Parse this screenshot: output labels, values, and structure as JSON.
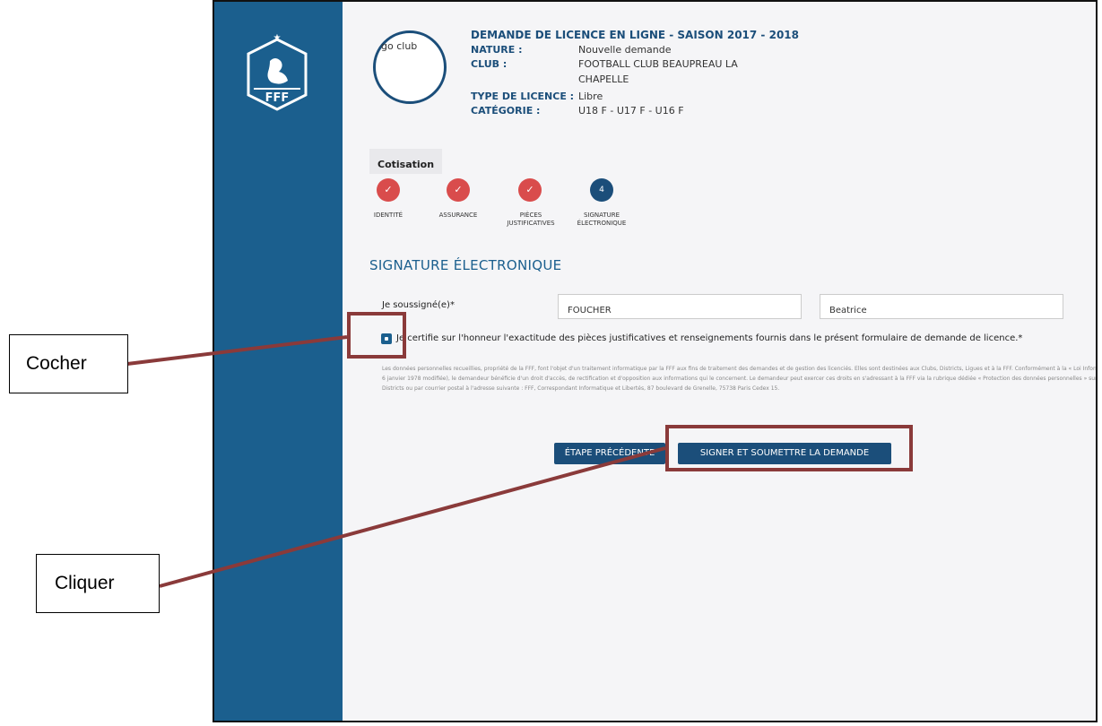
{
  "header": {
    "title": "DEMANDE DE LICENCE EN LIGNE - SAISON 2017 - 2018",
    "club_logo_text": "go club",
    "rows": [
      {
        "label": "NATURE :",
        "value": "Nouvelle demande"
      },
      {
        "label": "CLUB :",
        "value": "FOOTBALL CLUB BEAUPREAU LA",
        "value2": "CHAPELLE"
      },
      {
        "label": "TYPE DE LICENCE :",
        "value": "Libre"
      },
      {
        "label": "CATÉGORIE :",
        "value": "U18 F - U17 F - U16 F"
      }
    ]
  },
  "tab": "Cotisation",
  "steps": [
    {
      "label": "IDENTITÉ",
      "state": "done",
      "symbol": "✓"
    },
    {
      "label": "ASSURANCE",
      "state": "done",
      "symbol": "✓"
    },
    {
      "label": "PIÈCES\nJUSTIFICATIVES",
      "state": "done",
      "symbol": "✓"
    },
    {
      "label": "SIGNATURE\nÉLECTRONIQUE",
      "state": "active",
      "symbol": "4"
    }
  ],
  "section_title": "SIGNATURE ÉLECTRONIQUE",
  "signature": {
    "label": "Je soussigné(e)*",
    "last_name": "FOUCHER",
    "first_name": "Beatrice"
  },
  "certify_text": "Je certifie sur l'honneur l'exactitude des pièces justificatives et renseignements fournis dans le présent formulaire de demande de licence.*",
  "legal_text": "Les données personnelles recueillies, propriété de la FFF, font l'objet d'un traitement informatique par la FFF aux fins de traitement des demandes et de gestion des licenciés. Elles sont destinées aux Clubs, Districts, Ligues et à la FFF. Conformément à la « Loi Informatique et Libertés » (loi n°78-17 du 6 janvier 1978 modifiée), le demandeur bénéficie d'un droit d'accès, de rectification et d'opposition aux informations qui le concernent. Le demandeur peut exercer ces droits en s'adressant à la FFF via la rubrique dédiée « Protection des données personnelles » sur les sites de la FFF, des Ligues et des Districts ou par courrier postal à l'adresse suivante : FFF, Correspondant Informatique et Libertés, 87 boulevard de Grenelle, 75738 Paris Cedex 15.",
  "buttons": {
    "previous": "ÉTAPE PRÉCÉDENTE",
    "submit": "SIGNER ET SOUMETTRE LA DEMANDE"
  },
  "annotations": {
    "cocher": "Cocher",
    "cliquer": "Cliquer"
  },
  "colors": {
    "sidebar": "#1b5f8e",
    "primary": "#1b4e7a",
    "step_done": "#d94c4c",
    "annotation": "#8a3a3a"
  },
  "logo_text": "FFF"
}
